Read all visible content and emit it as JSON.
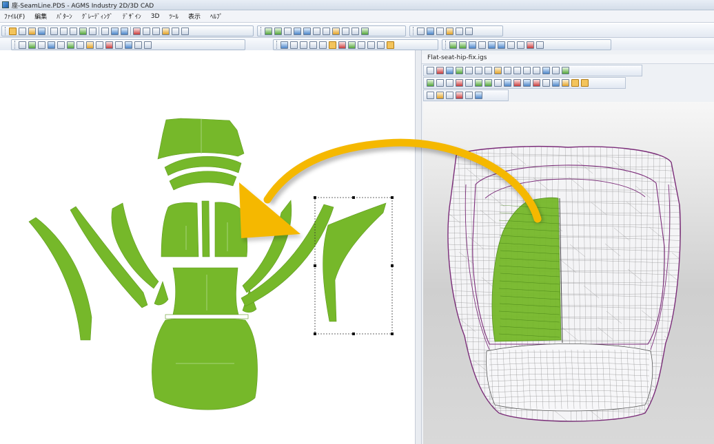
{
  "window": {
    "title": "座-SeamLine.PDS - AGMS Industry 2D/3D CAD"
  },
  "menu": {
    "items": [
      "ﾌｧｲﾙ(F)",
      "編集",
      "ﾊﾟﾀｰﾝ",
      "ｸﾞﾚｰﾃﾞｨﾝｸﾞ",
      "ﾃﾞｻﾞｲﾝ",
      "3D",
      "ﾂｰﾙ",
      "表示",
      "ﾍﾙﾌﾟ"
    ]
  },
  "viewer3d": {
    "document_tab": "Flat-seat-hip-fix.igs"
  },
  "colors": {
    "pattern_fill": "#76b82a",
    "arrow": "#f5b800",
    "mesh_wire": "#6b6b6b",
    "seam_line": "#7a2a78"
  },
  "icons": [
    "select-arrow-icon",
    "new-file-icon",
    "open-folder-icon",
    "save-icon",
    "print-icon",
    "zoom-icon",
    "undo-icon",
    "redo-icon",
    "cut-icon",
    "copy-icon",
    "paste-icon",
    "help-icon"
  ]
}
